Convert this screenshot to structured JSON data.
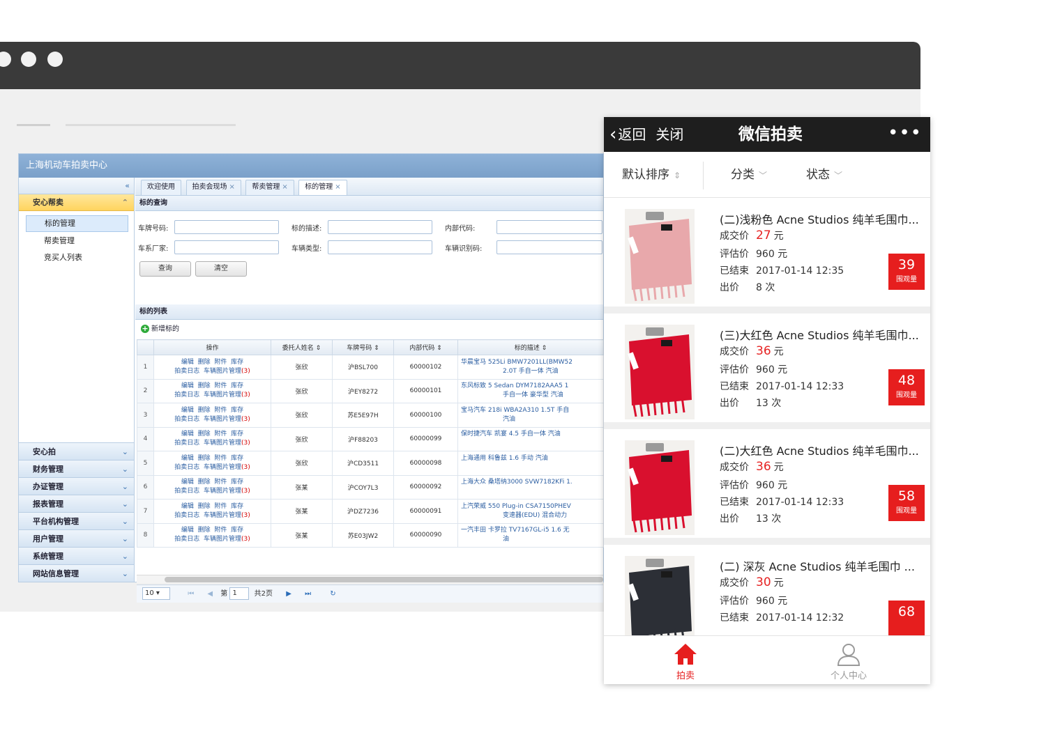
{
  "admin": {
    "title": "上海机动车拍卖中心",
    "sidebar": {
      "open_group": "安心帮卖",
      "items": [
        {
          "label": "标的管理",
          "active": true
        },
        {
          "label": "帮卖管理",
          "active": false
        },
        {
          "label": "竞买人列表",
          "active": false
        }
      ],
      "groups": [
        "安心拍",
        "财务管理",
        "办证管理",
        "报表管理",
        "平台机构管理",
        "用户管理",
        "系统管理",
        "网站信息管理"
      ]
    },
    "tabs": [
      {
        "label": "欢迎使用",
        "closable": false,
        "active": false
      },
      {
        "label": "拍卖会现场",
        "closable": true,
        "active": false
      },
      {
        "label": "帮卖管理",
        "closable": true,
        "active": false
      },
      {
        "label": "标的管理",
        "closable": true,
        "active": true
      }
    ],
    "search": {
      "title": "标的查询",
      "fields": [
        "车牌号码:",
        "标的描述:",
        "内部代码:",
        "车系厂家:",
        "车辆类型:",
        "车辆识别码:"
      ],
      "query_button": "查询",
      "clear_button": "清空"
    },
    "list": {
      "title": "标的列表",
      "add_label": "新增标的",
      "columns": [
        "操作",
        "委托人姓名 ⇕",
        "车牌号码 ⇕",
        "内部代码 ⇕",
        "标的描述 ⇕"
      ],
      "op_links_line1": [
        "编辑",
        "删除",
        "附件",
        "库存"
      ],
      "op_link_log": "拍卖日志",
      "op_link_photos": "车辆图片管理",
      "rows": [
        {
          "idx": "1",
          "owner": "张欣",
          "plate": "沪BSL700",
          "code": "60000102",
          "desc1": "华晨宝马 525Li BMW7201LL(BMW52",
          "desc2": "2.0T 手自一体 汽油",
          "photos": "(3)"
        },
        {
          "idx": "2",
          "owner": "张欣",
          "plate": "沪EY8272",
          "code": "60000101",
          "desc1": "东风标致 5 Sedan DYM7182AAA5 1",
          "desc2": "手自一体 豪华型 汽油",
          "photos": "(3)"
        },
        {
          "idx": "3",
          "owner": "张欣",
          "plate": "苏E5E97H",
          "code": "60000100",
          "desc1": "宝马汽车 218i WBA2A310 1.5T 手自",
          "desc2": "汽油",
          "photos": "(3)"
        },
        {
          "idx": "4",
          "owner": "张欣",
          "plate": "沪F88203",
          "code": "60000099",
          "desc1": "保时捷汽车 凯宴 4.5 手自一体 汽油",
          "desc2": "",
          "photos": "(3)"
        },
        {
          "idx": "5",
          "owner": "张欣",
          "plate": "沪CD3511",
          "code": "60000098",
          "desc1": "上海通用 科鲁兹 1.6 手动 汽油",
          "desc2": "",
          "photos": "(3)"
        },
        {
          "idx": "6",
          "owner": "张某",
          "plate": "沪COY7L3",
          "code": "60000092",
          "desc1": "上海大众 桑塔纳3000 SVW7182KFi 1.",
          "desc2": "",
          "photos": "(3)"
        },
        {
          "idx": "7",
          "owner": "张某",
          "plate": "沪DZ7236",
          "code": "60000091",
          "desc1": "上汽荣威 550 Plug-in CSA7150PHEV",
          "desc2": "变速器(EDU) 混合动力",
          "photos": "(3)"
        },
        {
          "idx": "8",
          "owner": "张某",
          "plate": "苏E03JW2",
          "code": "60000090",
          "desc1": "一汽丰田 卡罗拉 TV7167GL-i5 1.6 无",
          "desc2": "油",
          "photos": "(3)"
        }
      ]
    },
    "pager": {
      "page_size": "10",
      "page_label": "第",
      "page_value": "1",
      "total_label": "共2页"
    }
  },
  "mobile": {
    "back_label": "返回",
    "close_label": "关闭",
    "title": "微信拍卖",
    "more_label": "•••",
    "filters": [
      {
        "label": "默认排序",
        "arrow": "⇕"
      },
      {
        "label": "分类",
        "arrow": "﹀"
      },
      {
        "label": "状态",
        "arrow": "﹀"
      }
    ],
    "row_labels": {
      "deal": "成交价",
      "estimate": "评估价",
      "ended": "已结束",
      "bids": "出价",
      "yuan": "元",
      "times": "次",
      "views": "围观量"
    },
    "items": [
      {
        "name": "(二)浅粉色 Acne Studios 纯羊毛围巾...",
        "deal_price": "27",
        "estimate": "960 元",
        "ended": "2017-01-14 12:35",
        "bids": "8 次",
        "views": "39",
        "scarf_color": "#e8a8ab"
      },
      {
        "name": "(三)大红色 Acne Studios 纯羊毛围巾...",
        "deal_price": "36",
        "estimate": "960 元",
        "ended": "2017-01-14 12:33",
        "bids": "13 次",
        "views": "48",
        "scarf_color": "#d9102e"
      },
      {
        "name": "(二)大红色 Acne Studios 纯羊毛围巾...",
        "deal_price": "36",
        "estimate": "960 元",
        "ended": "2017-01-14 12:33",
        "bids": "13 次",
        "views": "58",
        "scarf_color": "#d9102e"
      },
      {
        "name": "(二) 深灰 Acne Studios 纯羊毛围巾 ...",
        "deal_price": "30",
        "estimate": "960 元",
        "ended": "2017-01-14 12:32",
        "bids": "",
        "views": "68",
        "scarf_color": "#2c2f36"
      }
    ],
    "tabbar": {
      "auction_label": "拍卖",
      "profile_label": "个人中心",
      "active_color": "#e61e1e"
    }
  }
}
